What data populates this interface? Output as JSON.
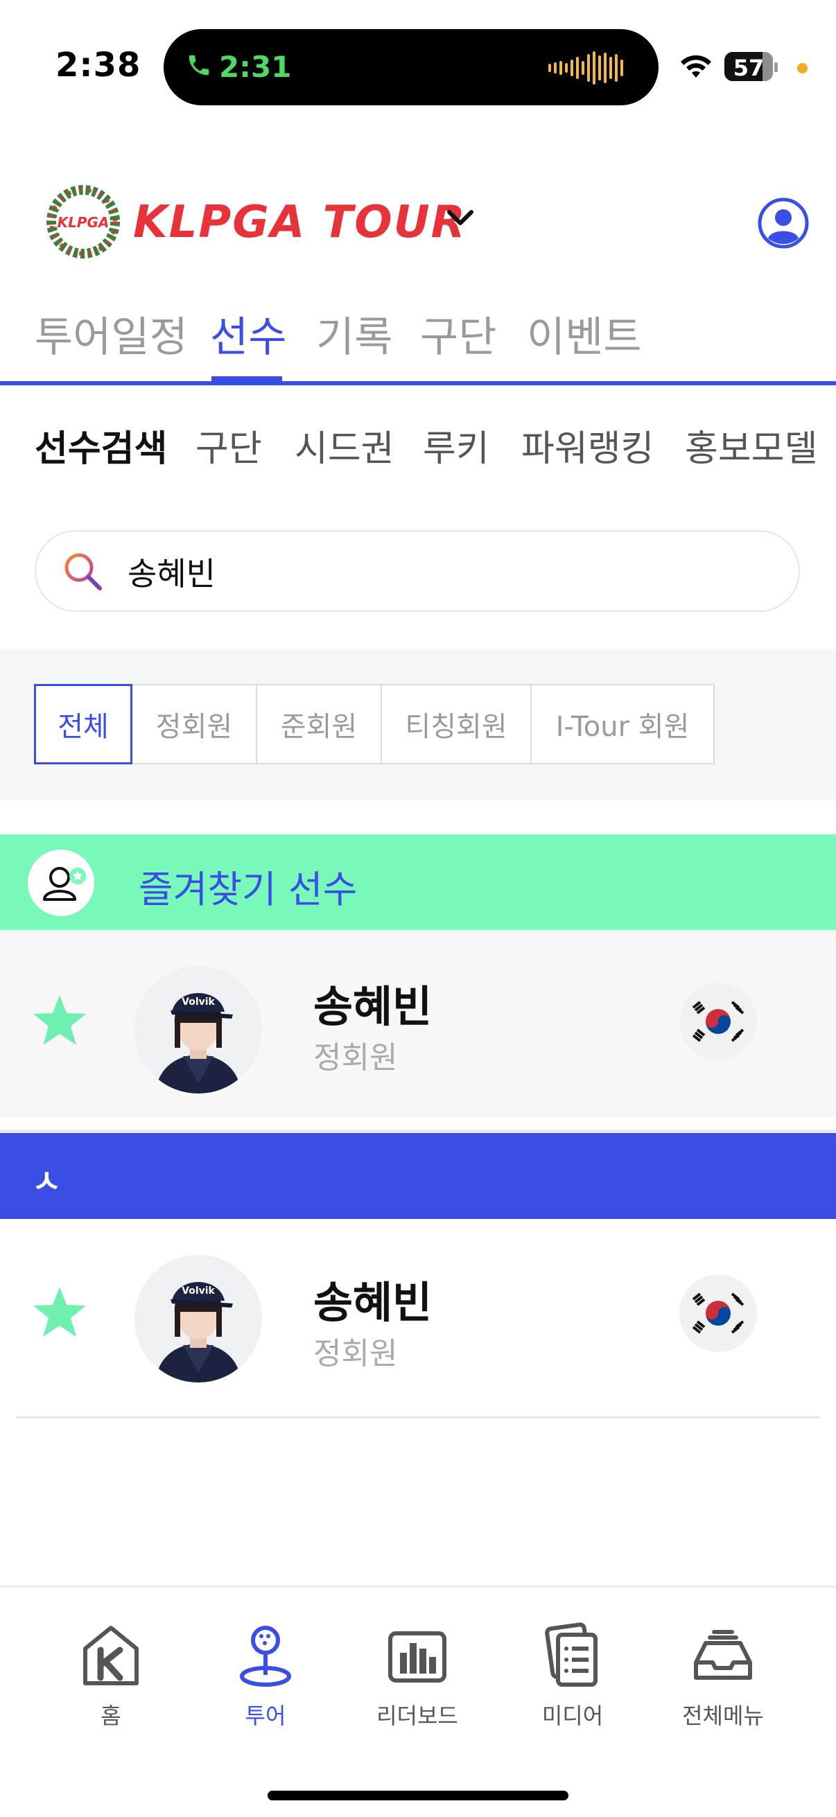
{
  "status_bar": {
    "time": "2:38",
    "call_time": "2:31",
    "battery": "57",
    "colors": {
      "call": "#4cd964",
      "privacy_dot": "#f5a623",
      "wave": "#f5b93a"
    }
  },
  "header": {
    "logo_text": "KLPGA TOUR",
    "logo_mark": "KLPGA",
    "dropdown_icon": "chevron-down-icon",
    "profile_icon": "user-circle-icon"
  },
  "main_nav": {
    "tabs": [
      {
        "label": "투어일정"
      },
      {
        "label": "선수",
        "active": true
      },
      {
        "label": "기록"
      },
      {
        "label": "구단"
      },
      {
        "label": "이벤트"
      }
    ]
  },
  "sub_nav": {
    "items": [
      {
        "label": "선수검색",
        "active": true
      },
      {
        "label": "구단"
      },
      {
        "label": "시드권"
      },
      {
        "label": "루키"
      },
      {
        "label": "파워랭킹"
      },
      {
        "label": "홍보모델"
      }
    ]
  },
  "search": {
    "value": "송혜빈",
    "icon": "search-icon"
  },
  "filters": [
    {
      "label": "전체",
      "active": true
    },
    {
      "label": "정회원"
    },
    {
      "label": "준회원"
    },
    {
      "label": "티칭회원"
    },
    {
      "label": "I-Tour 회원"
    }
  ],
  "favorites": {
    "label": "즐겨찾기 선수",
    "icon": "user-star-icon"
  },
  "favorite_players": [
    {
      "name": "송혜빈",
      "membership": "정회원",
      "starred": true,
      "flag": "south-korea-flag-icon"
    }
  ],
  "sections": [
    {
      "letter": "ㅅ",
      "players": [
        {
          "name": "송혜빈",
          "membership": "정회원",
          "starred": true,
          "flag": "south-korea-flag-icon"
        }
      ]
    }
  ],
  "bottom_tabs": [
    {
      "label": "홈",
      "icon": "home-icon"
    },
    {
      "label": "투어",
      "icon": "golf-tour-icon",
      "active": true
    },
    {
      "label": "리더보드",
      "icon": "leaderboard-icon"
    },
    {
      "label": "미디어",
      "icon": "media-icon"
    },
    {
      "label": "전체메뉴",
      "icon": "inbox-menu-icon"
    }
  ],
  "colors": {
    "accent": "#3a4ee6",
    "mint": "#78f9b9",
    "star": "#6ff0b0",
    "logo_red": "#e8323a"
  }
}
